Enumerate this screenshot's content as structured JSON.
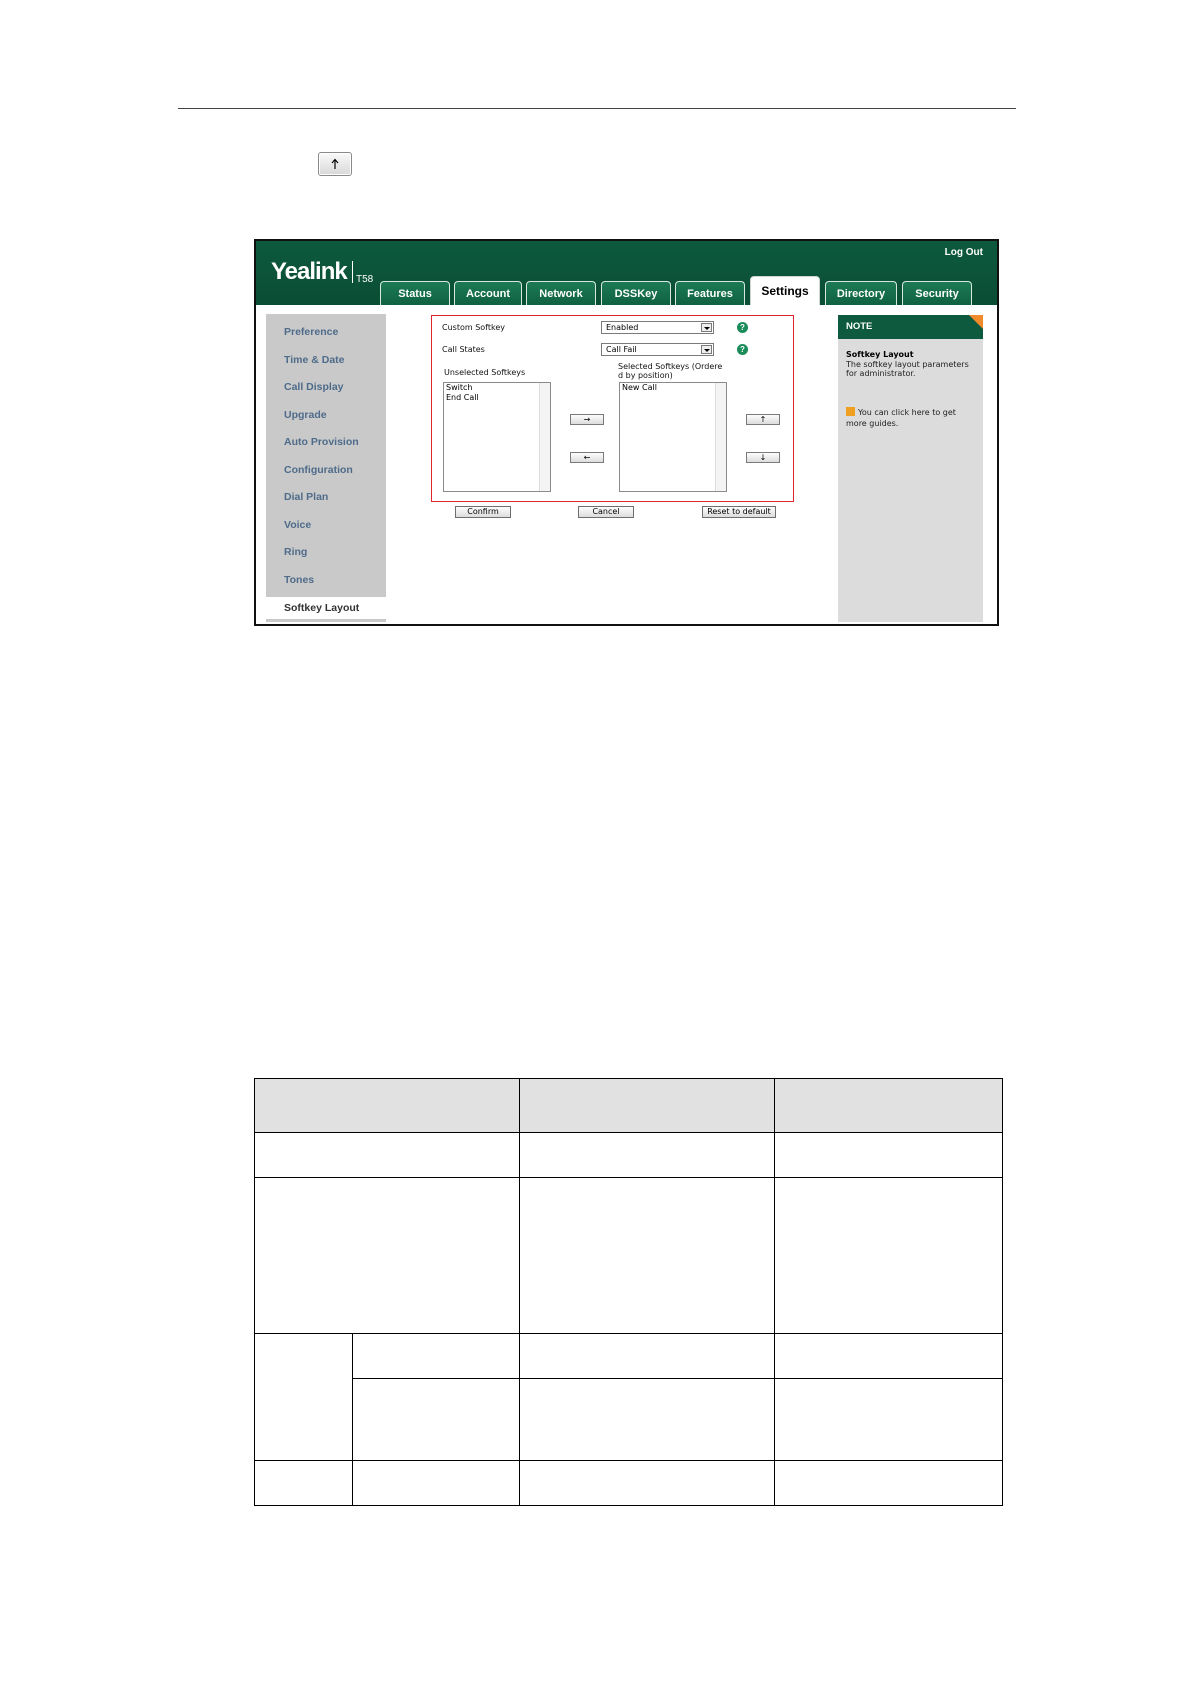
{
  "toolbar_icon": "up-arrow-icon",
  "screenshot": {
    "brand": "Yealink",
    "model": "T58",
    "logout": "Log Out",
    "tabs": [
      "Status",
      "Account",
      "Network",
      "DSSKey",
      "Features",
      "Settings",
      "Directory",
      "Security"
    ],
    "active_tab": "Settings",
    "sidebar": [
      "Preference",
      "Time & Date",
      "Call Display",
      "Upgrade",
      "Auto Provision",
      "Configuration",
      "Dial Plan",
      "Voice",
      "Ring",
      "Tones",
      "Softkey Layout"
    ],
    "active_sidebar": "Softkey Layout",
    "form": {
      "custom_softkey_label": "Custom Softkey",
      "custom_softkey_value": "Enabled",
      "call_states_label": "Call States",
      "call_states_value": "Call Fail",
      "unselected_label": "Unselected Softkeys",
      "selected_label_1": "Selected Softkeys (Ordere",
      "selected_label_2": "d by position)",
      "unselected_items": [
        "Switch",
        "End Call"
      ],
      "selected_items": [
        "New Call"
      ],
      "move_right": "→",
      "move_left": "←",
      "move_up": "↑",
      "move_down": "↓",
      "confirm": "Confirm",
      "cancel": "Cancel",
      "reset": "Reset to default"
    },
    "note": {
      "header": "NOTE",
      "title": "Softkey Layout",
      "text": "The softkey layout parameters for administrator.",
      "link": "You can click here to get more guides."
    }
  },
  "colors": {
    "header_green": "#0d5a3e",
    "sidebar_link": "#4e6b8a",
    "highlight_red": "#e0242d",
    "table_header": "#e1e1e1"
  }
}
